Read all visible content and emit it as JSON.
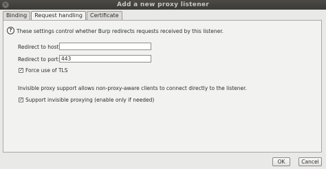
{
  "window": {
    "title": "Add a new proxy listener",
    "close_glyph": "×"
  },
  "tabs": [
    {
      "label": "Binding"
    },
    {
      "label": "Request handling",
      "active": true
    },
    {
      "label": "Certificate"
    }
  ],
  "help_icon": {
    "glyph": "?"
  },
  "intro_text": "These settings control whether Burp redirects requests received by this listener.",
  "redirect_host": {
    "label": "Redirect to host:",
    "value": ""
  },
  "redirect_port": {
    "label": "Redirect to port:",
    "value": "443"
  },
  "force_tls": {
    "label": "Force use of TLS",
    "checked": true
  },
  "invisible_text": "Invisible proxy support allows non-proxy-aware clients to connect directly to the listener.",
  "invisible_proxying": {
    "label": "Support invisible proxying (enable only if needed)",
    "checked": true
  },
  "buttons": {
    "ok": "OK",
    "cancel": "Cancel"
  }
}
